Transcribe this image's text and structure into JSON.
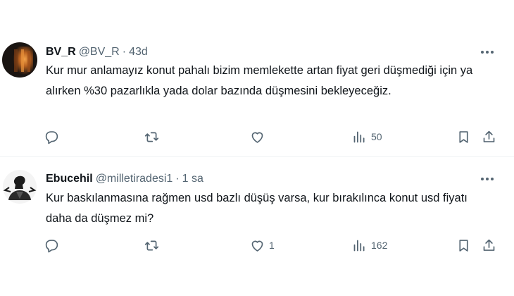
{
  "tweets": [
    {
      "name": "BV_R",
      "handle": "@BV_R",
      "separator": "·",
      "time": "43d",
      "text": "Kur mur anlamayız konut pahalı bizim memlekette artan fiyat geri düşmediği için ya alırken %30 pazarlıkla yada dolar bazında düşmesini bekleyeceğiz.",
      "likes": "",
      "views": "50"
    },
    {
      "name": "Ebucehil",
      "handle": "@milletiradesi1",
      "separator": "·",
      "time": "1 sa",
      "text": "Kur baskılanmasına rağmen usd bazlı düşüş varsa, kur bırakılınca konut usd fiyatı daha da düşmez mi?",
      "likes": "1",
      "views": "162"
    }
  ],
  "icons": {
    "reply": "reply-icon",
    "retweet": "retweet-icon",
    "like": "heart-icon",
    "views": "views-icon",
    "bookmark": "bookmark-icon",
    "share": "share-icon",
    "more": "more-icon"
  },
  "colors": {
    "text": "#0f1419",
    "secondary": "#536471",
    "divider": "#eff3f4"
  }
}
